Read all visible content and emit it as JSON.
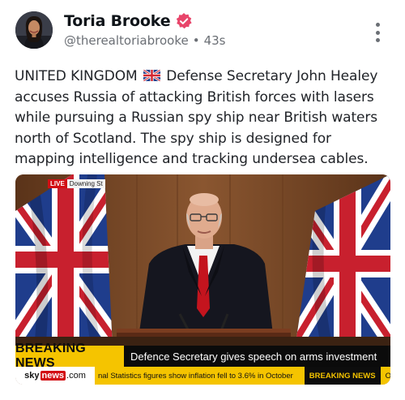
{
  "post": {
    "author_name": "Toria Brooke",
    "handle": "@therealtoriabrooke",
    "separator": "•",
    "time_ago": "43s",
    "text_prefix": "UNITED KINGDOM",
    "text_body": "Defense Secretary John Healey accuses Russia of attacking British forces with lasers while pursuing a Russian spy ship near British waters north of Scotland. The spy ship is designed for mapping intelligence and tracking undersea cables."
  },
  "icons": {
    "verified": "verified-badge-icon",
    "more": "more-vertical-icon",
    "flag": "uk-flag-emoji"
  },
  "media": {
    "live_label": "LIVE",
    "location": "Downing St",
    "breaking_label": "BREAKING NEWS",
    "headline": "Defence Secretary gives speech on arms investment",
    "channel_brand": "sky",
    "channel_brand_box": "news",
    "channel_brand_suffix": ".com",
    "ticker_text": "nal Statistics figures show inflation fell to 3.6% in October",
    "ticker_breaking": "BREAKING NEWS",
    "ticker_tail": "Office"
  },
  "colors": {
    "verified": "#e8456a",
    "breaking_yellow": "#f5c400",
    "live_red": "#d20f14",
    "handle_gray": "#6b6f75"
  }
}
